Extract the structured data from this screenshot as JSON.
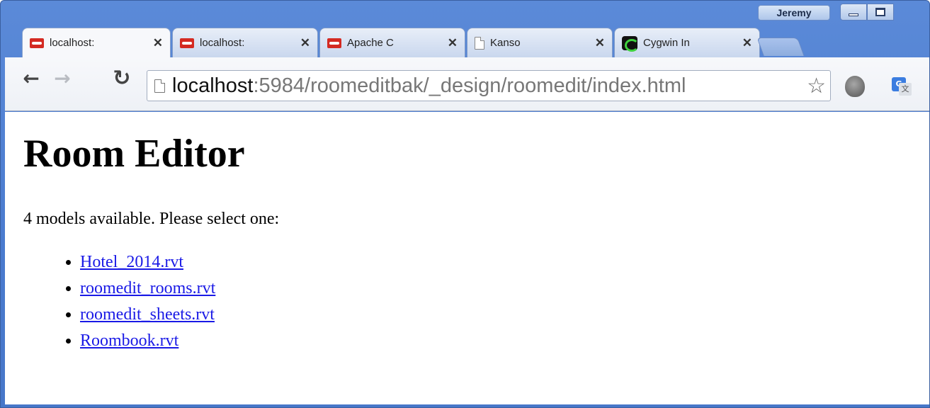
{
  "window": {
    "user_name": "Jeremy"
  },
  "tabs": [
    {
      "label": "localhost:",
      "icon": "couchdb-icon",
      "active": true
    },
    {
      "label": "localhost:",
      "icon": "couchdb-icon",
      "active": false
    },
    {
      "label": "Apache C",
      "icon": "couchdb-icon",
      "active": false
    },
    {
      "label": "Kanso",
      "icon": "document-icon",
      "active": false
    },
    {
      "label": "Cygwin In",
      "icon": "cygwin-icon",
      "active": false
    }
  ],
  "toolbar": {
    "url_host": "localhost",
    "url_rest": ":5984/roomeditbak/_design/roomedit/index.html",
    "translate_badge": "G",
    "translate_badge_alt": "文"
  },
  "page": {
    "heading": "Room Editor",
    "intro": "4 models available. Please select one:",
    "models": [
      "Hotel_2014.rvt",
      "roomedit_rooms.rvt",
      "roomedit_sheets.rvt",
      "Roombook.rvt"
    ]
  },
  "colors": {
    "frame": "#4a7bcf",
    "link": "#1a1ae6"
  }
}
